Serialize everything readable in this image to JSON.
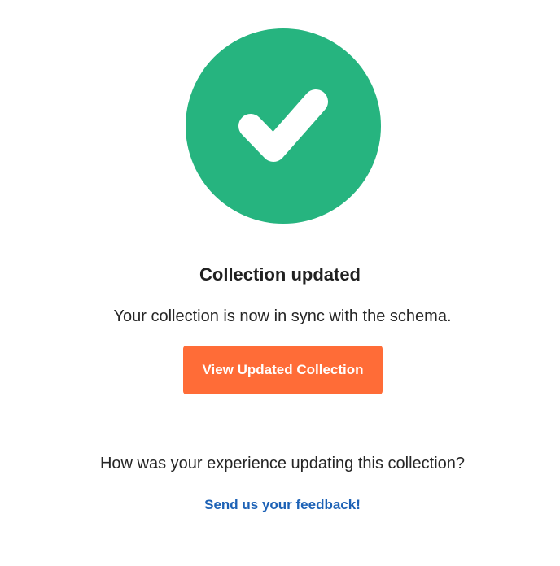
{
  "status": {
    "icon": "checkmark-icon",
    "color": "#26b47f"
  },
  "title": "Collection updated",
  "message": "Your collection is now in sync with the schema.",
  "primary_button": {
    "label": "View Updated Collection",
    "color": "#ff6c37"
  },
  "feedback": {
    "question": "How was your experience updating this collection?",
    "link_label": "Send us your feedback!",
    "link_color": "#1d62b6"
  }
}
